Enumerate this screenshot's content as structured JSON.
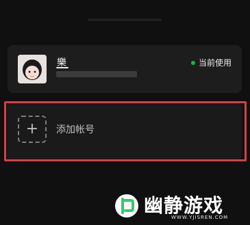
{
  "account": {
    "name": "樂",
    "status": "当前使用"
  },
  "add_account": {
    "label": "添加帐号"
  },
  "watermark": {
    "brand": "幽静游戏",
    "url": "WWW.YJISREN.COM"
  },
  "colors": {
    "status_dot": "#17b34d",
    "highlight": "#d6404a",
    "brand_green": "#35c96e"
  },
  "icons": {
    "status": "active-dot-icon",
    "add": "plus-icon",
    "watermark_logo": "brand-logo-icon"
  }
}
